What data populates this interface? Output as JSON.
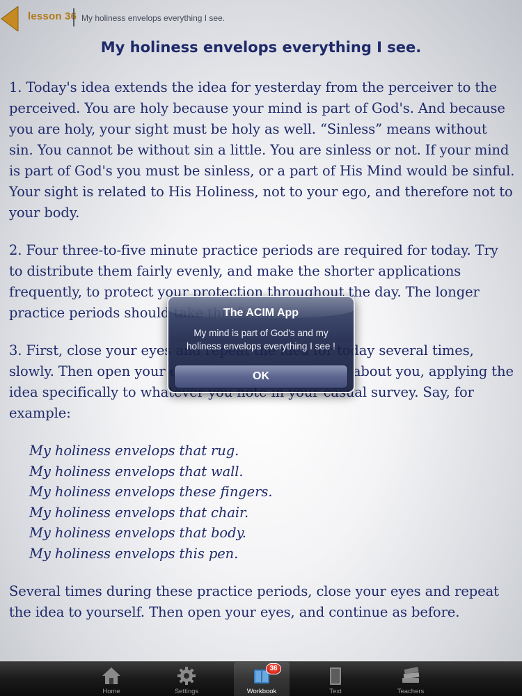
{
  "header": {
    "lesson_label": "lesson 36",
    "subtitle": "My holiness envelops everything I see."
  },
  "lesson": {
    "title": "My holiness envelops everything I see.",
    "paragraph1": "1. Today's idea extends the idea for yesterday from the perceiver to the perceived. You are holy because your mind is part of God's. And because you are holy, your sight must be holy as well. “Sinless” means without sin. You cannot be without sin a little. You are sinless or not. If your mind is part of God's you must be sinless, or a part of His Mind would be sinful. Your sight is related to His Holiness, not to your ego, and therefore not to your body.",
    "paragraph2": "2. Four three-to-five minute practice periods are required for today. Try to distribute them fairly evenly, and make the shorter applications frequently, to protect your protection throughout the day. The longer practice periods should take this form:",
    "paragraph3": "3. First, close your eyes and repeat the idea for today several times, slowly. Then open your eyes and look quite slowly about you, applying the idea specifically to whatever you note in your casual survey. Say, for example:",
    "examples": [
      "My holiness envelops that rug.",
      "My holiness envelops that wall.",
      "My holiness envelops these fingers.",
      "My holiness envelops that chair.",
      "My holiness envelops that body.",
      "My holiness envelops this pen."
    ],
    "paragraph4": "Several times during these practice periods, close your eyes and repeat the idea to yourself. Then open your eyes, and continue as before."
  },
  "alert": {
    "title": "The ACIM App",
    "message": "My mind is part of God's and my holiness envelops everything I see !",
    "button_label": "OK"
  },
  "tabbar": {
    "items": [
      {
        "label": "Home",
        "icon": "home-icon"
      },
      {
        "label": "Settings",
        "icon": "gear-icon"
      },
      {
        "label": "Workbook",
        "icon": "workbook-icon",
        "badge": "36",
        "active": true
      },
      {
        "label": "Text",
        "icon": "book-icon"
      },
      {
        "label": "Teachers",
        "icon": "books-stack-icon"
      }
    ]
  },
  "colors": {
    "text": "#1f2a6a",
    "accent": "#b0791a",
    "badge": "#d8251a"
  }
}
